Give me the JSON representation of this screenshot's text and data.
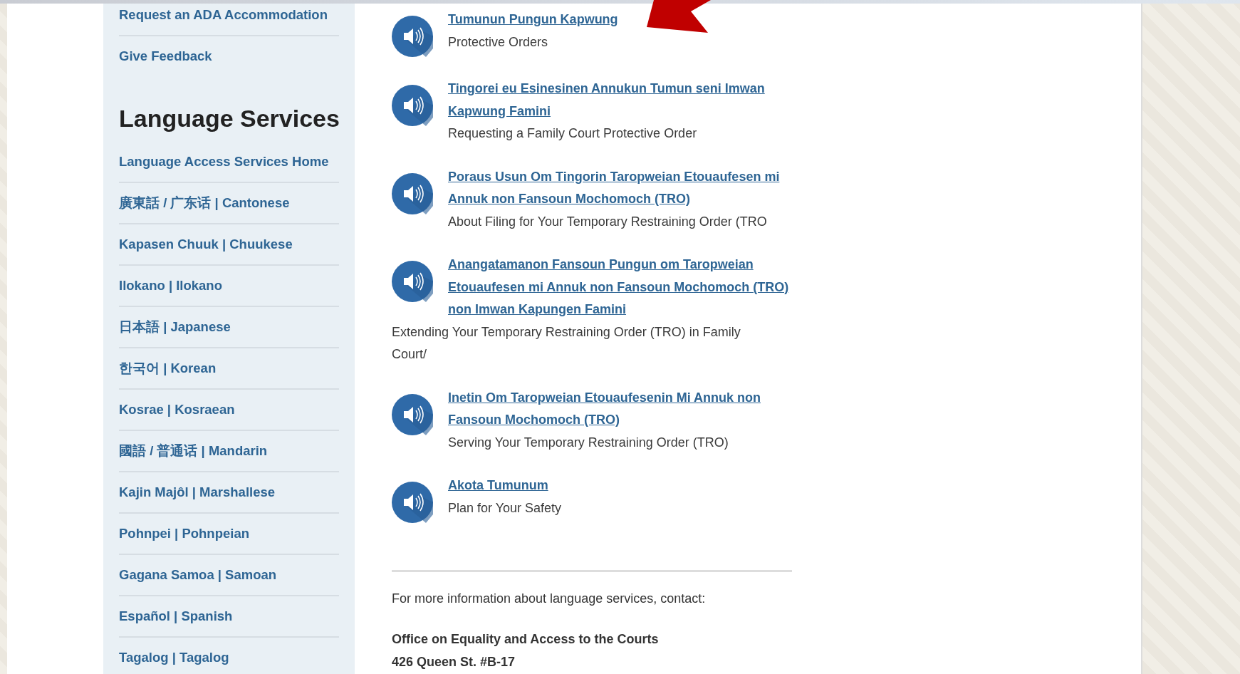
{
  "sidebar": {
    "top_links": [
      "Request an ADA Accommodation",
      "Give Feedback"
    ],
    "heading": "Language Services",
    "links": [
      "Language Access Services Home",
      "廣東話 / 广东话 | Cantonese",
      "Kapasen Chuuk | Chuukese",
      "Ilokano | Ilokano",
      "日本語 | Japanese",
      "한국어 | Korean",
      "Kosrae | Kosraean",
      "國語 / 普通话 | Mandarin",
      "Kajin Majôl | Marshallese",
      "Pohnpei | Pohnpeian",
      "Gagana Samoa | Samoan",
      "Español | Spanish",
      "Tagalog | Tagalog"
    ]
  },
  "audio_items": [
    {
      "title": "Tumunun Pungun Kapwung",
      "description": "Protective Orders",
      "kind": "indented"
    },
    {
      "title": "Tingorei eu Esinesinen Annukun Tumun seni Imwan Kapwung Famini",
      "description": "Requesting a Family Court Protective Order",
      "kind": "indented"
    },
    {
      "title": "Poraus Usun Om Tingorin Taropweian Etouaufesen mi Annuk non Fansoun Mochomoch (TRO)",
      "description": "About Filing for Your Temporary Restraining Order (TRO",
      "kind": "indented"
    },
    {
      "title": "Anangatamanon Fansoun Pungun om Taropweian Etouaufesen mi Annuk non Fansoun Mochomoch (TRO) non Imwan Kapungen Famini",
      "description": "Extending Your Temporary Restraining Order (TRO) in Family Court/",
      "kind": "flush"
    },
    {
      "title": "Inetin Om Taropweian Etouaufesenin Mi Annuk non Fansoun Mochomoch (TRO)",
      "description": "Serving Your Temporary Restraining Order (TRO)",
      "kind": "indented"
    },
    {
      "title": "Akota Tumunum",
      "description": "Plan for Your Safety",
      "kind": "indented"
    }
  ],
  "contact": {
    "intro": "For more information about language services, contact:",
    "office": "Office on Equality and Access to the Courts",
    "address": "426 Queen St. #B-17"
  }
}
